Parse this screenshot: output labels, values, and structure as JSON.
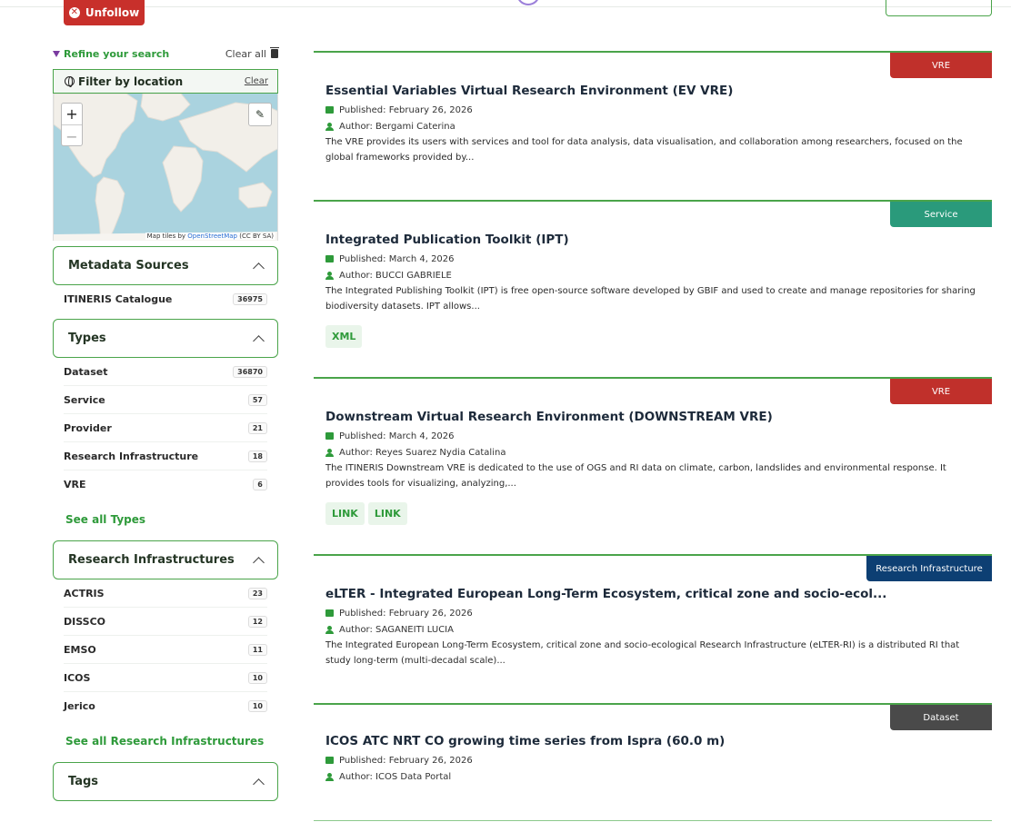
{
  "header": {
    "unfollow_label": "Unfollow"
  },
  "sidebar": {
    "refine_label": "Refine your search",
    "clear_all_label": "Clear all",
    "filter_location": {
      "title": "Filter by location",
      "clear_label": "Clear",
      "zoom_in": "+",
      "zoom_out": "−",
      "attribution_prefix": "Map tiles by ",
      "attribution_link": "OpenStreetMap",
      "attribution_license": " (CC BY SA)"
    },
    "facets": {
      "metadata_sources": {
        "title": "Metadata Sources",
        "items": [
          {
            "label": "ITINERIS Catalogue",
            "count": "36975"
          }
        ]
      },
      "types": {
        "title": "Types",
        "items": [
          {
            "label": "Dataset",
            "count": "36870"
          },
          {
            "label": "Service",
            "count": "57"
          },
          {
            "label": "Provider",
            "count": "21"
          },
          {
            "label": "Research Infrastructure",
            "count": "18"
          },
          {
            "label": "VRE",
            "count": "6"
          }
        ],
        "see_all": "See all Types"
      },
      "research_infrastructures": {
        "title": "Research Infrastructures",
        "items": [
          {
            "label": "ACTRIS",
            "count": "23"
          },
          {
            "label": "DISSCO",
            "count": "12"
          },
          {
            "label": "EMSO",
            "count": "11"
          },
          {
            "label": "ICOS",
            "count": "10"
          },
          {
            "label": "Jerico",
            "count": "10"
          }
        ],
        "see_all": "See all Research Infrastructures"
      },
      "tags": {
        "title": "Tags"
      }
    }
  },
  "results": [
    {
      "badge": "VRE",
      "badge_color": "#c0302b",
      "title": "Essential Variables Virtual Research Environment (EV VRE)",
      "published": "Published: February 26, 2026",
      "author": "Author: Bergami Caterina",
      "description": "The VRE provides its users with services and tool for data analysis, data visualisation, and collaboration among researchers, focused on the global frameworks provided by...",
      "tags": []
    },
    {
      "badge": "Service",
      "badge_color": "#2a9a7b",
      "title": "Integrated Publication Toolkit (IPT)",
      "published": "Published: March 4, 2026",
      "author": "Author: BUCCI GABRIELE",
      "description": "The Integrated Publishing Toolkit (IPT) is free open-source software developed by GBIF and used to create and manage repositories for sharing biodiversity datasets. IPT allows...",
      "tags": [
        "XML"
      ]
    },
    {
      "badge": "VRE",
      "badge_color": "#c0302b",
      "title": "Downstream Virtual Research Environment (DOWNSTREAM VRE)",
      "published": "Published: March 4, 2026",
      "author": "Author: Reyes Suarez Nydia Catalina",
      "description": "The ITINERIS Downstream VRE is dedicated to the use of OGS and RI data on climate, carbon, landslides and environmental response. It provides tools for visualizing, analyzing,...",
      "tags": [
        "LINK",
        "LINK"
      ]
    },
    {
      "badge": "Research Infrastructure",
      "badge_color": "#0d3f73",
      "title": "eLTER - Integrated European Long-Term Ecosystem, critical zone and socio-ecol...",
      "published": "Published: February 26, 2026",
      "author": "Author: SAGANEITI LUCIA",
      "description": "The Integrated European Long-Term Ecosystem, critical zone and socio-ecological Research Infrastructure (eLTER-RI) is a distributed RI that study long-term (multi-decadal scale)...",
      "tags": []
    },
    {
      "badge": "Dataset",
      "badge_color": "#4a4a4a",
      "title": "ICOS ATC NRT CO growing time series from Ispra (60.0 m)",
      "published": "Published: February 26, 2026",
      "author": "Author: ICOS Data Portal",
      "description": "",
      "tags": []
    }
  ]
}
